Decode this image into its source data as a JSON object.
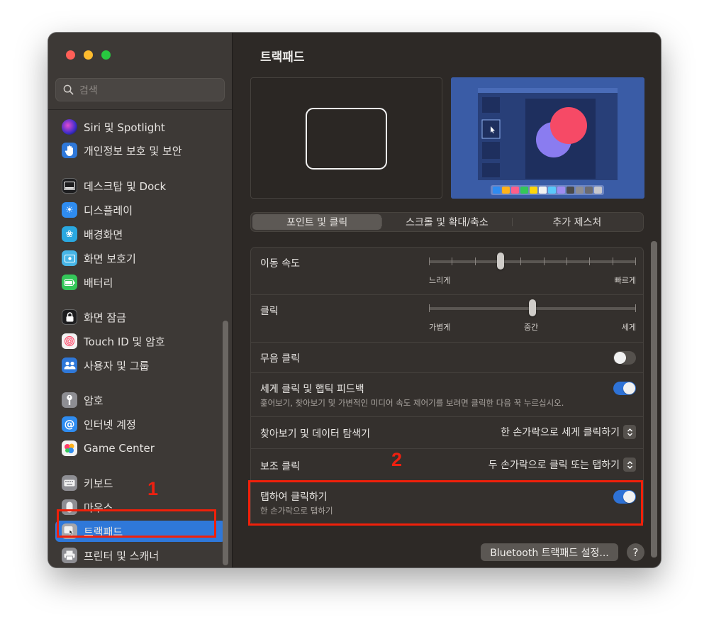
{
  "window": {
    "title": "트랙패드"
  },
  "sidebar": {
    "search_placeholder": "검색",
    "items": [
      {
        "label": "Siri 및 Spotlight",
        "icon": "siri-icon",
        "color": "#5b3fd1"
      },
      {
        "label": "개인정보 보호 및 보안",
        "icon": "hand-icon",
        "color": "#2f78d9"
      },
      {
        "label": "데스크탑 및 Dock",
        "icon": "dock-icon",
        "color": "#1d1d1f"
      },
      {
        "label": "디스플레이",
        "icon": "sun-icon",
        "color": "#2f8cf0"
      },
      {
        "label": "배경화면",
        "icon": "flower-icon",
        "color": "#2aa8e0"
      },
      {
        "label": "화면 보호기",
        "icon": "screensaver-icon",
        "color": "#47b5e6"
      },
      {
        "label": "배터리",
        "icon": "battery-icon",
        "color": "#34c759"
      },
      {
        "label": "화면 잠금",
        "icon": "lock-icon",
        "color": "#1d1d1f"
      },
      {
        "label": "Touch ID 및 암호",
        "icon": "fingerprint-icon",
        "color": "#f2f2f2"
      },
      {
        "label": "사용자 및 그룹",
        "icon": "users-icon",
        "color": "#2f78d9"
      },
      {
        "label": "암호",
        "icon": "key-icon",
        "color": "#8e8e93"
      },
      {
        "label": "인터넷 계정",
        "icon": "at-icon",
        "color": "#2f8cf0"
      },
      {
        "label": "Game Center",
        "icon": "game-center-icon",
        "color": "#f2f2f2"
      },
      {
        "label": "키보드",
        "icon": "keyboard-icon",
        "color": "#8e8e93"
      },
      {
        "label": "마우스",
        "icon": "mouse-icon",
        "color": "#8e8e93"
      },
      {
        "label": "트랙패드",
        "icon": "trackpad-icon",
        "color": "#8e8e93",
        "selected": true
      },
      {
        "label": "프린터 및 스캐너",
        "icon": "printer-icon",
        "color": "#8e8e93"
      }
    ]
  },
  "tabs": [
    {
      "label": "포인트 및 클릭",
      "selected": true
    },
    {
      "label": "스크롤 및 확대/축소",
      "selected": false
    },
    {
      "label": "추가 제스처",
      "selected": false
    }
  ],
  "settings": {
    "tracking_speed": {
      "label": "이동 속도",
      "min_label": "느리게",
      "max_label": "빠르게",
      "value_fraction": 0.34,
      "ticks": 10
    },
    "click": {
      "label": "클릭",
      "labels": [
        "가볍게",
        "중간",
        "세게"
      ],
      "value_fraction": 0.5,
      "ticks": 3
    },
    "silent_click": {
      "label": "무음 클릭",
      "enabled": false
    },
    "force_click": {
      "label": "세게 클릭 및 햅틱 피드백",
      "description": "훑어보기, 찾아보기 및 가변적인 미디어 속도 제어기를 보려면 클릭한 다음 꾹 누르십시오.",
      "enabled": true
    },
    "lookup": {
      "label": "찾아보기 및 데이터 탐색기",
      "value": "한 손가락으로 세게 클릭하기"
    },
    "secondary_click": {
      "label": "보조 클릭",
      "value": "두 손가락으로 클릭 또는 탭하기"
    },
    "tap_to_click": {
      "label": "탭하여 클릭하기",
      "description": "한 손가락으로 탭하기",
      "enabled": true
    }
  },
  "footer": {
    "bluetooth_button": "Bluetooth 트랙패드 설정...",
    "help_button": "?"
  },
  "annotations": {
    "one": "1",
    "two": "2",
    "color": "#f0200a"
  }
}
